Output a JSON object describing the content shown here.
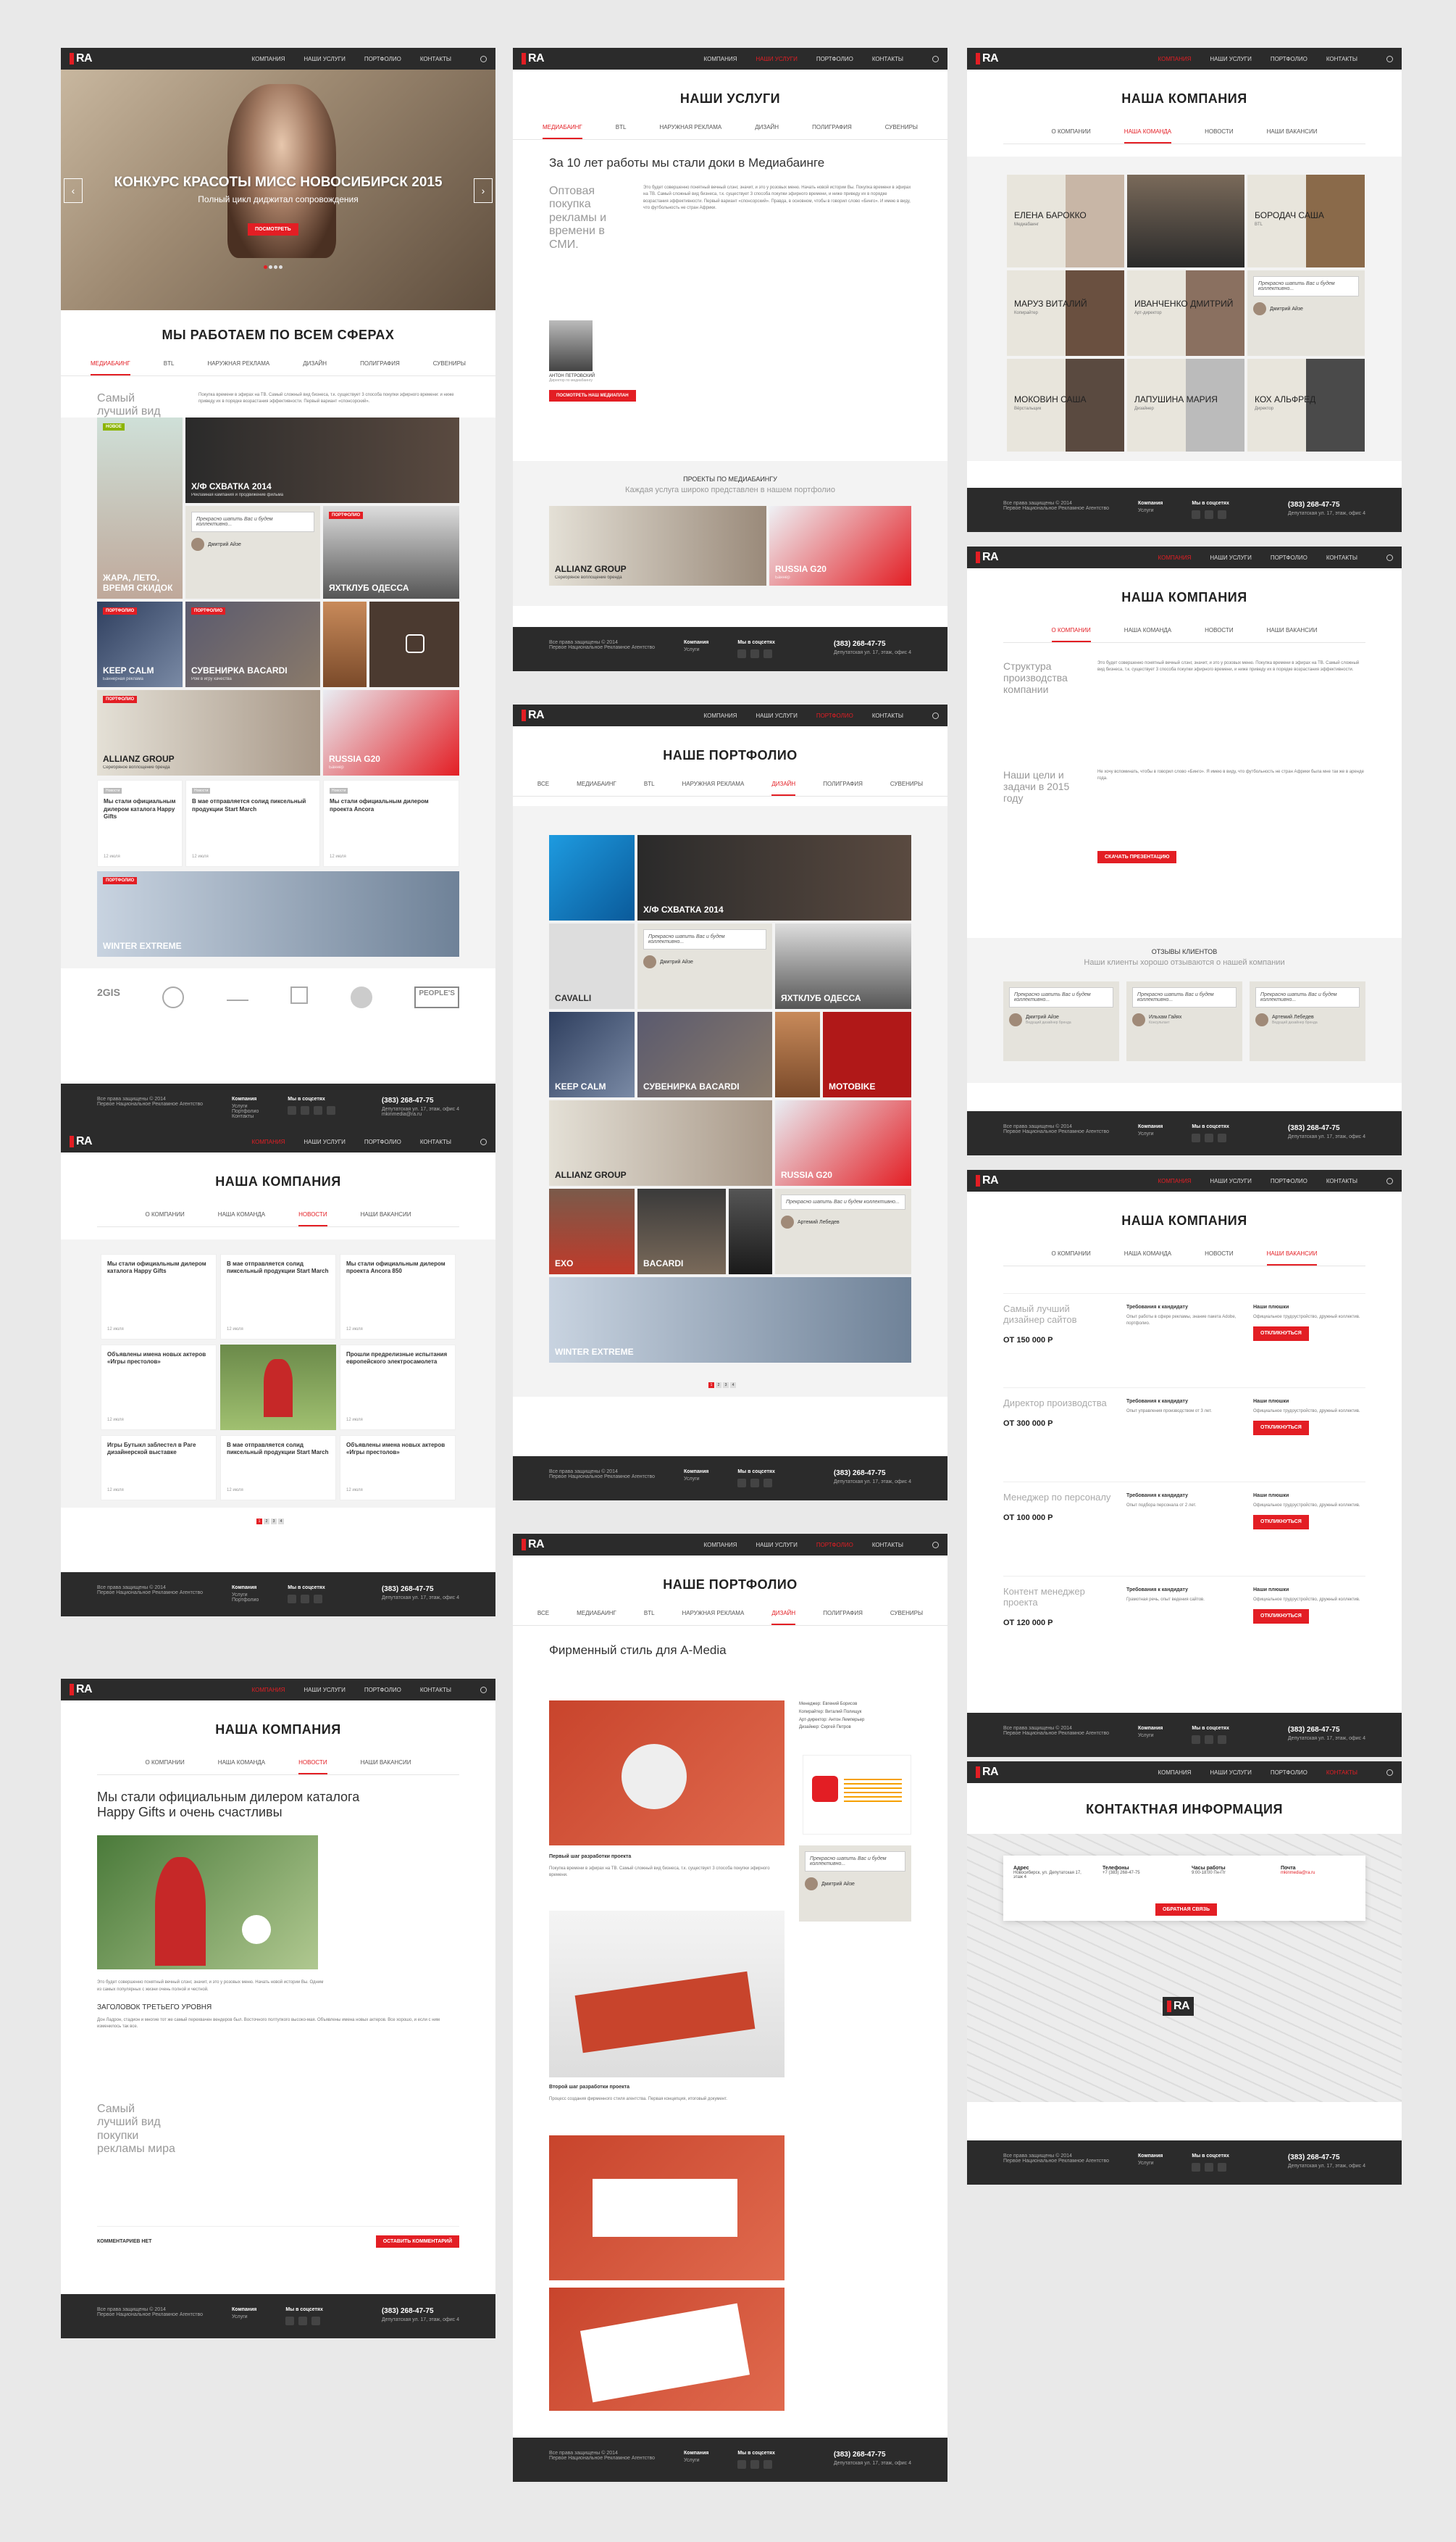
{
  "common": {
    "logo": "RA",
    "nav": [
      "Компания",
      "Наши услуги",
      "Портфолио",
      "Контакты"
    ],
    "footer": {
      "copy": "Все права защищены © 2014",
      "agency": "Первое Национальное Рекламное Агентство",
      "links": [
        "Компания",
        "Услуги",
        "Портфолио",
        "Контакты"
      ],
      "social": "Мы в соцсетях",
      "phone": "(383) 268-47-75",
      "address": "Депутатская ул. 17, этаж, офис 4",
      "email": "mkinmedia@ra.ru"
    }
  },
  "home": {
    "slide_title": "КОНКУРС КРАСОТЫ МИСС НОВОСИБИРСК 2015",
    "slide_sub": "Полный цикл диджитал сопровождения",
    "slide_btn": "Посмотреть",
    "heading": "Мы работаем по всем сферах",
    "tabs": [
      "Медиабаинг",
      "BTL",
      "Наружная реклама",
      "Дизайн",
      "Полиграфия",
      "Сувениры"
    ],
    "lead": "Самый лучший вид покупки рекламы мира",
    "tiles": [
      {
        "t": "Х/Ф Схватка 2014",
        "s": "Рекламная кампания и продвижение фильма"
      },
      {
        "t": "Жара, лето, время скидок",
        "s": ""
      },
      {
        "t": "Яхтклуб Одесса",
        "s": ""
      },
      {
        "t": "Keep Calm",
        "s": "Баннерная реклама"
      },
      {
        "t": "Сувенирка Bacardi",
        "s": "Ром в игру качества"
      },
      {
        "t": "Allianz Group",
        "s": "Серебряное воплощение бренда"
      },
      {
        "t": "Russia G20",
        "s": "Баннер"
      },
      {
        "t": "Winter Extreme",
        "s": "Интернет промо"
      }
    ],
    "quote": "Прекрасно шапить Вас и будем коллективно...",
    "quote_name": "Дмитрий Айзе",
    "quote_role": "Ведущий дизайнер бренда",
    "news": [
      {
        "tag": "Новости",
        "t": "Мы стали официальным дилером каталога Happy Gifts",
        "d": "12 июля"
      },
      {
        "tag": "Новости",
        "t": "В мае отправляется солид пиксельный продукции Start March",
        "d": "12 июля"
      },
      {
        "tag": "Новости",
        "t": "Мы стали официальным дилером проекта Ancora",
        "d": "12 июля"
      }
    ],
    "clients": [
      "2GIS",
      "",
      "",
      "",
      "",
      "PEOPLE'S"
    ]
  },
  "services": {
    "title": "Наши услуги",
    "tabs": [
      "Медиабаинг",
      "BTL",
      "Наружная реклама",
      "Дизайн",
      "Полиграфия",
      "Сувениры"
    ],
    "headline": "За 10 лет работы мы стали доки в Медиабаинге",
    "lead": "Оптовая покупка рекламы и времени в СМИ.",
    "author": "Антон Петровский",
    "author_role": "Директор по медиабаингу",
    "btn": "Посмотреть наш медиаплан",
    "projects_title": "Проекты по медиабаингу",
    "projects_sub": "Каждая услуга широко представлен в нашем портфолио",
    "p1": "Allianz Group",
    "p1s": "Серебряное воплощение бренда",
    "p2": "Russia G20",
    "p2s": "Баннер"
  },
  "portfolio": {
    "title": "Наше портфолио",
    "tabs": [
      "Все",
      "Медиабаинг",
      "BTL",
      "Наружная реклама",
      "Дизайн",
      "Полиграфия",
      "Сувениры"
    ],
    "tiles": [
      "Х/Ф Схватка 2014",
      "Cavalli",
      "Яхтклуб Одесса",
      "Keep Calm",
      "Сувенирка Bacardi",
      "Motobike",
      "Allianz Group",
      "Russia G20",
      "EXO",
      "Bacardi",
      "Winter Extreme"
    ],
    "quote_name2": "Артемий Лебедев",
    "quote_role2": "БТЛ Нового уровня"
  },
  "project": {
    "title": "Наше портфолио",
    "headline": "Фирменный стиль для A-Media",
    "step1": "Первый шаг разработки проекта",
    "step2": "Второй шаг разработки проекта",
    "meta": [
      "Менеджер: Евгений Борисов",
      "Копирайтер: Виталий Полищук",
      "Арт-директор: Антон Лемперьер",
      "Дизайнер: Сергей Петров"
    ]
  },
  "company_team": {
    "title": "Наша компания",
    "tabs": [
      "О компании",
      "Наша команда",
      "Новости",
      "Наши вакансии"
    ],
    "people": [
      {
        "n": "Елена Барокко",
        "r": "Медиабаинг"
      },
      {
        "n": "Бородач Саша",
        "r": "BTL"
      },
      {
        "n": "Маруз Виталий",
        "r": "Копирайтер"
      },
      {
        "n": "Иванченко Дмитрий",
        "r": "Арт-директор"
      },
      {
        "n": "Моковин Саша",
        "r": "Вёрстальщик"
      },
      {
        "n": "Лапушина Мария",
        "r": "Дизайнер"
      },
      {
        "n": "Кох Альфред",
        "r": "Директор"
      }
    ]
  },
  "company_news": {
    "title": "Наша компания",
    "news": [
      "Мы стали официальным дилером каталога Happy Gifts",
      "В мае отправляется солид пиксельный продукции Start March",
      "Мы стали официальным дилером проекта Ancora 850",
      "Объявлены имена новых актеров «Игры престолов»",
      "",
      "Прошли предрелизные испытания европейского электросамолета",
      "Игры Бутыкл заблестел в Раге дизайнерской выставке",
      "В мае отправляется солид пиксельный продукции Start March",
      "Объявлены имена новых актеров «Игры престолов»"
    ],
    "date": "12 июля"
  },
  "company_about": {
    "title": "Наша компания",
    "lead1": "Структура производства компании",
    "lead2": "Наши цели и задачи в 2015 году",
    "btn": "Скачать презентацию",
    "reviews_title": "Отзывы клиентов",
    "reviews_sub": "Наши клиенты хорошо отзываются о нашей компании",
    "reviewers": [
      {
        "n": "Дмитрий Айзе",
        "r": "Ведущий дизайнер бренда"
      },
      {
        "n": "Ильхам Гайях",
        "r": "Консультант"
      },
      {
        "n": "Артемий Лебедев",
        "r": "Ведущий дизайнер бренда"
      }
    ]
  },
  "article": {
    "title": "Наша компания",
    "headline": "Мы стали официальным дилером каталога Happy Gifts и очень счастливы",
    "subhead": "Заголовок третьего уровня",
    "lead": "Самый лучший вид покупки рекламы мира",
    "comments": "Комментариев нет",
    "btn": "Оставить комментарий"
  },
  "jobs": {
    "title": "Наша компания",
    "reqs": "Требования к кандидату",
    "duties": "Наши плюшки",
    "btn": "Откликнуться",
    "items": [
      {
        "t": "Самый лучший дизайнер сайтов",
        "p": "ОТ 150 000 Р"
      },
      {
        "t": "Директор производства",
        "p": "ОТ 300 000 Р"
      },
      {
        "t": "Менеджер по персоналу",
        "p": "ОТ 100 000 Р"
      },
      {
        "t": "Контент менеджер проекта",
        "p": "ОТ 120 000 Р"
      }
    ]
  },
  "contacts": {
    "title": "Контактная информация",
    "cols": [
      {
        "h": "Адрес",
        "v": "Новосибирск, ул. Депутатская 17, этаж 4"
      },
      {
        "h": "Телефоны",
        "v": "+7 (383) 268-47-75"
      },
      {
        "h": "Часы работы",
        "v": "9:00-18:00 Пн-Пт"
      },
      {
        "h": "Почта",
        "v": "mkinmedia@ra.ru"
      }
    ],
    "btn": "Обратная связь"
  }
}
